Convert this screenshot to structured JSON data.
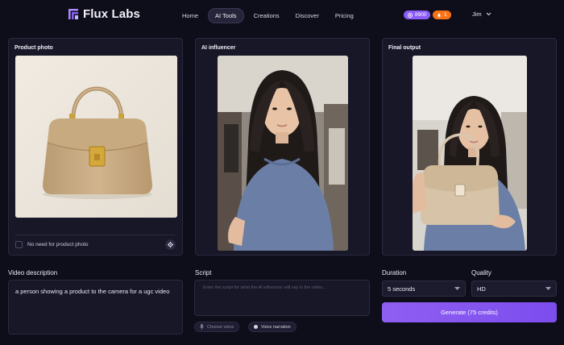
{
  "brand": {
    "name": "Flux Labs"
  },
  "nav": [
    {
      "label": "Home",
      "active": false
    },
    {
      "label": "AI Tools",
      "active": true
    },
    {
      "label": "Creations",
      "active": false
    },
    {
      "label": "Discover",
      "active": false
    },
    {
      "label": "Pricing",
      "active": false
    }
  ],
  "header": {
    "credits": "8900",
    "alerts": "1",
    "user_name": "Jim"
  },
  "panels": {
    "product": {
      "title": "Product photo",
      "checkbox_label": "No need for product photo"
    },
    "influencer": {
      "title": "AI influencer"
    },
    "output": {
      "title": "Final output"
    }
  },
  "video_description": {
    "label": "Video description",
    "value": "a person showing a product to the camera for a ugc video"
  },
  "script": {
    "label": "Script",
    "placeholder": "Enter the script for what the AI influencer will say in the video...",
    "choose_voice": "Choose voice",
    "voice_narration": "Voice narration"
  },
  "duration": {
    "label": "Duration",
    "value": "5 seconds"
  },
  "quality": {
    "label": "Quality",
    "value": "HD"
  },
  "generate": {
    "label": "Generate (75 credits)"
  },
  "colors": {
    "accent": "#8b5cf6",
    "alert": "#f97316",
    "background": "#0e0d1a",
    "panel": "#181728"
  }
}
